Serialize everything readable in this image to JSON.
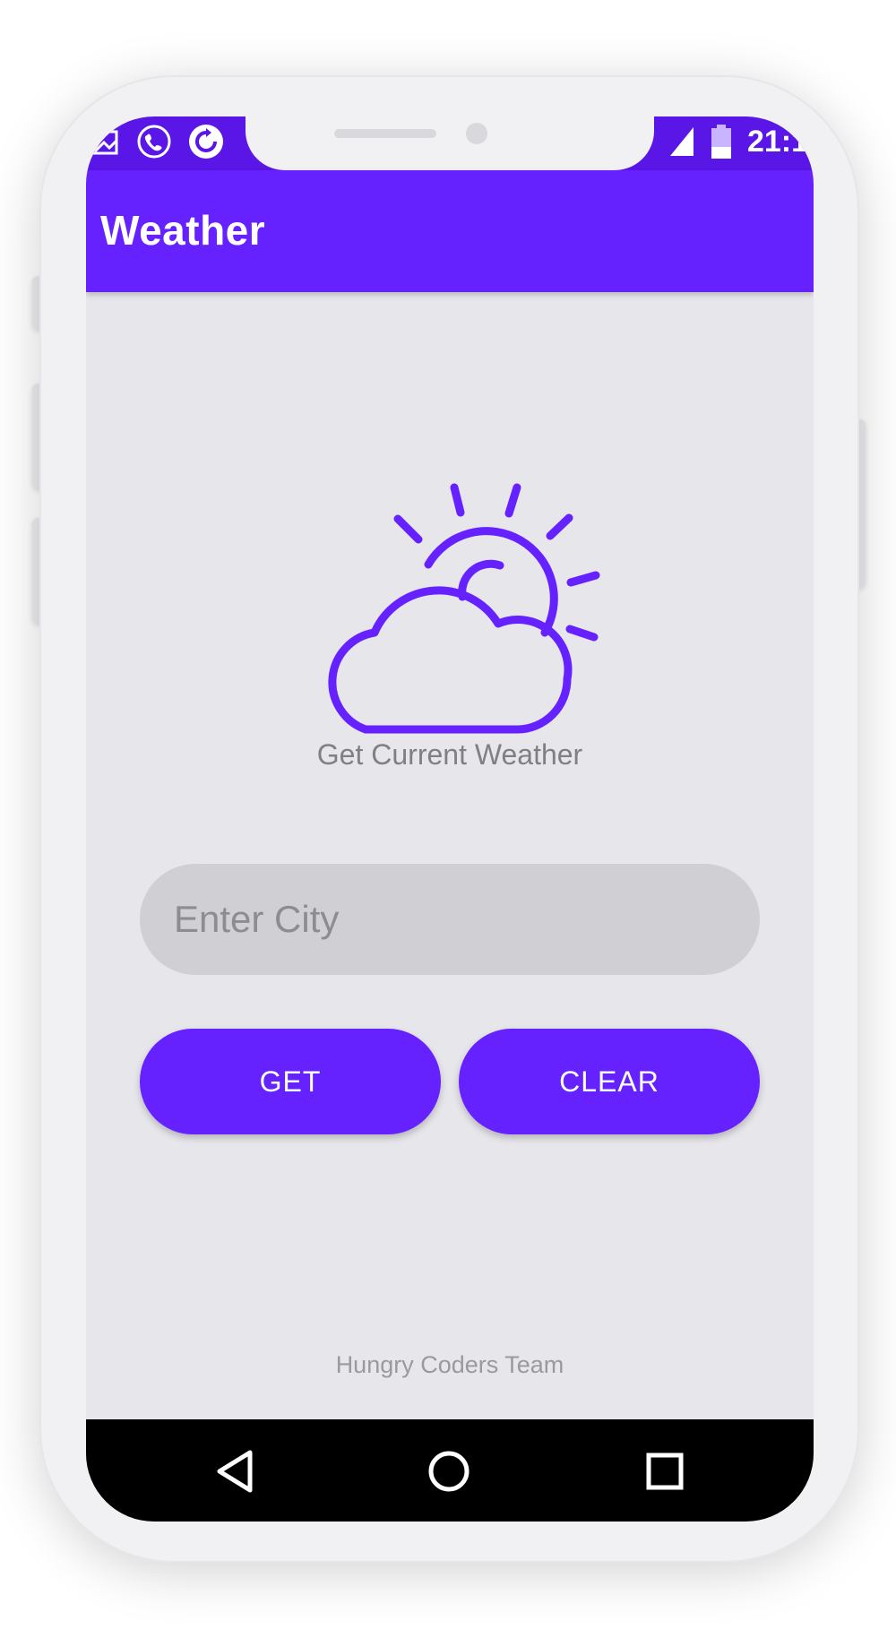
{
  "app": {
    "title": "Weather"
  },
  "status_bar": {
    "time": "21:1",
    "icons": [
      "image-icon",
      "phone-call-icon",
      "sync-icon",
      "signal-icon",
      "battery-icon"
    ]
  },
  "main": {
    "icon": "cloud-sun-icon",
    "subtitle": "Get Current Weather",
    "city_input": {
      "placeholder": "Enter City",
      "value": ""
    },
    "buttons": {
      "get_label": "GET",
      "clear_label": "CLEAR"
    },
    "footer": "Hungry Coders Team"
  },
  "nav_bar": {
    "items": [
      "back-icon",
      "home-icon",
      "recents-icon"
    ]
  },
  "colors": {
    "primary": "#6621ff",
    "status_bar": "#5a16e6",
    "background": "#e7e6eb",
    "input_background": "#cfcfd4",
    "nav_bar": "#000000"
  }
}
